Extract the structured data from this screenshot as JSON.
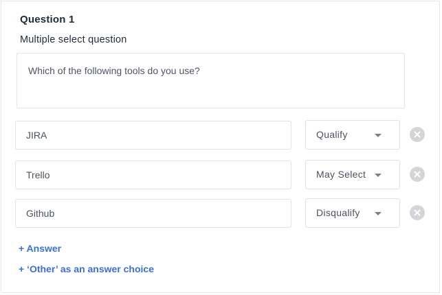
{
  "question": {
    "title": "Question 1",
    "type_label": "Multiple select question",
    "text": "Which of the following tools do you use?"
  },
  "answers": [
    {
      "value": "JIRA",
      "rule": "Qualify"
    },
    {
      "value": "Trello",
      "rule": "May Select"
    },
    {
      "value": "Github",
      "rule": "Disqualify"
    }
  ],
  "actions": {
    "add_answer": "+ Answer",
    "add_other": "+ ‘Other’ as an answer choice"
  },
  "icons": {
    "remove": "close-circle-icon",
    "dropdown": "chevron-down-icon"
  },
  "colors": {
    "link": "#3b6fd8",
    "remove_icon": "#d3d5d9",
    "border": "#dfe2e6"
  }
}
